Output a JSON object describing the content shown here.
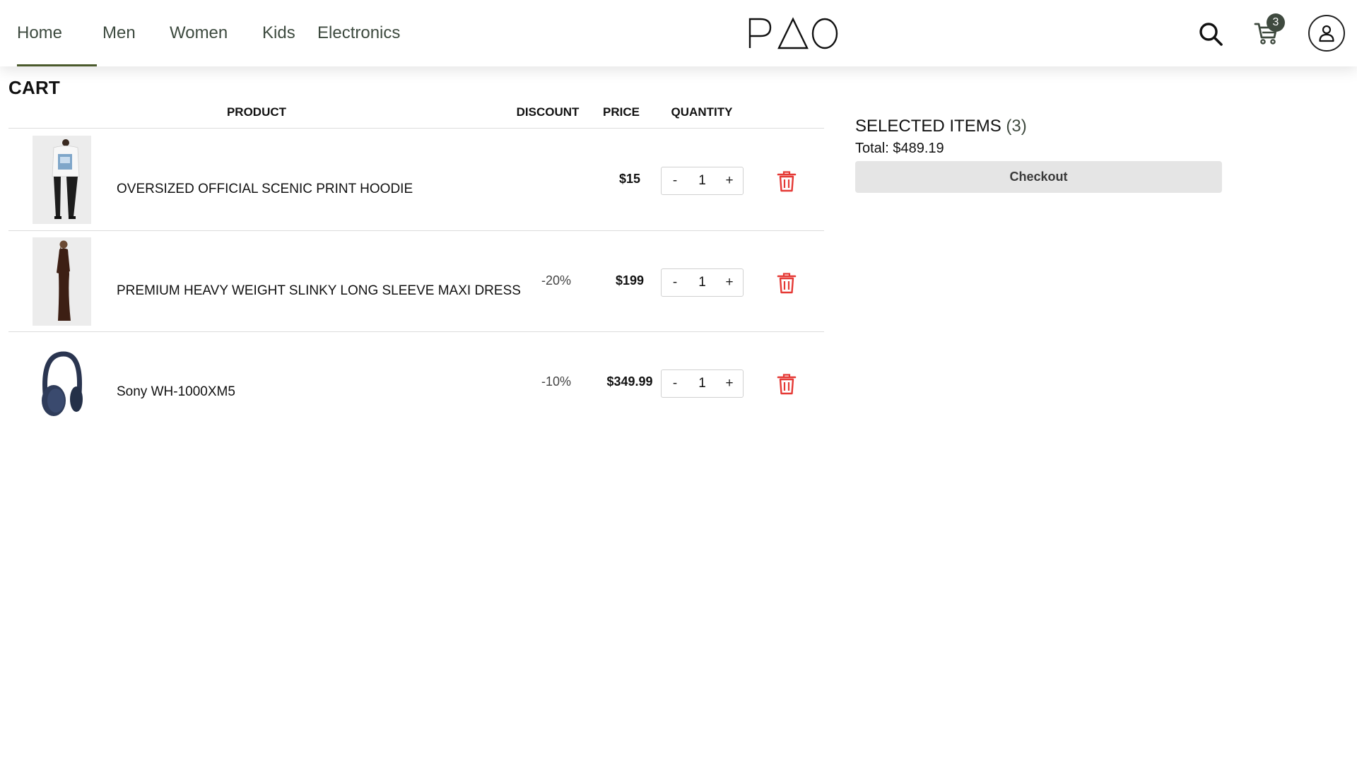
{
  "nav": {
    "links": [
      "Home",
      "Men",
      "Women",
      "Kids",
      "Electronics"
    ],
    "active": "Home",
    "brand": "PAO",
    "cart_count": "3",
    "search_icon": "search-icon",
    "cart_icon": "shopping-cart-icon",
    "account_icon": "user-icon"
  },
  "cart": {
    "title": "CART",
    "headers": {
      "product": "PRODUCT",
      "discount": "DISCOUNT",
      "price": "PRICE",
      "quantity": "QUANTITY"
    },
    "items": [
      {
        "name": "OVERSIZED OFFICIAL SCENIC PRINT HOODIE",
        "discount": "",
        "price": "$15",
        "quantity": "1",
        "minus": "-",
        "plus": "+"
      },
      {
        "name": "PREMIUM HEAVY WEIGHT SLINKY LONG SLEEVE MAXI DRESS",
        "discount": "-20%",
        "price": "$199",
        "quantity": "1",
        "minus": "-",
        "plus": "+"
      },
      {
        "name": "Sony WH-1000XM5",
        "discount": "-10%",
        "price": "$349.99",
        "quantity": "1",
        "minus": "-",
        "plus": "+"
      }
    ],
    "delete_icon": "trash-icon",
    "delete_color": "#e53935"
  },
  "summary": {
    "title": "SELECTED ITEMS",
    "count": "(3)",
    "total": "Total: $489.19",
    "checkout_label": "Checkout"
  },
  "colors": {
    "accent": "#3f4a3f",
    "nav_text": "#3d4a3f",
    "active_underline": "#4a5a2c",
    "checkout_bg": "#e5e5e5"
  }
}
